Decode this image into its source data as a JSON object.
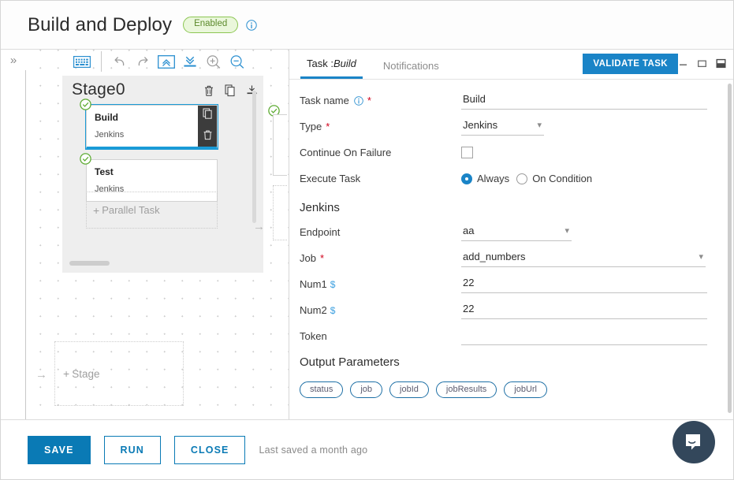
{
  "header": {
    "title": "Build and Deploy",
    "status_badge": "Enabled",
    "info_icon": "info-circle-icon",
    "badge_color": "#8cc653"
  },
  "canvas_toolbar": {
    "collapse_label": "»",
    "buttons": [
      {
        "name": "keyboard-icon",
        "glyph": "keyboard"
      },
      {
        "name": "undo-icon",
        "glyph": "undo"
      },
      {
        "name": "redo-icon",
        "glyph": "redo"
      },
      {
        "name": "collapse-all-icon",
        "glyph": "collapse-all"
      },
      {
        "name": "expand-all-icon",
        "glyph": "expand-all"
      },
      {
        "name": "zoom-in-icon",
        "glyph": "zoom-in"
      },
      {
        "name": "zoom-out-icon",
        "glyph": "zoom-out"
      }
    ]
  },
  "canvas": {
    "stage": {
      "title": "Stage0",
      "tools": [
        "delete-icon",
        "copy-icon",
        "collapse-icon"
      ],
      "tasks": [
        {
          "name": "Build",
          "type": "Jenkins",
          "selected": true
        },
        {
          "name": "Test",
          "type": "Jenkins",
          "selected": false
        }
      ],
      "parallel_task_label": "Parallel Task",
      "plus": "+"
    },
    "add_stage_label": "Stage",
    "add_stage_plus": "+"
  },
  "panel": {
    "tabs": [
      {
        "label_prefix": "Task :",
        "label_italic": "Build",
        "active": true,
        "name": "tab-task"
      },
      {
        "label_prefix": "Notifications",
        "label_italic": "",
        "active": false,
        "name": "tab-notifications"
      }
    ],
    "validate_button": "VALIDATE TASK",
    "window_controls": [
      "minimize-icon",
      "maximize-icon",
      "split-icon"
    ],
    "fields": {
      "task_name_label": "Task name",
      "task_name_value": "Build",
      "task_name_required": "*",
      "type_label": "Type",
      "type_required": "*",
      "type_value": "Jenkins",
      "type_options": [
        "Jenkins"
      ],
      "continue_on_failure_label": "Continue On Failure",
      "continue_on_failure_checked": false,
      "execute_task_label": "Execute Task",
      "execute_always_label": "Always",
      "execute_on_condition_label": "On Condition",
      "execute_selected": "Always"
    },
    "jenkins": {
      "section_title": "Jenkins",
      "endpoint_label": "Endpoint",
      "endpoint_value": "aa",
      "endpoint_options": [
        "aa"
      ],
      "job_label": "Job",
      "job_required": "*",
      "job_value": "add_numbers",
      "job_options": [
        "add_numbers"
      ],
      "num1_label": "Num1",
      "num1_value": "22",
      "num2_label": "Num2",
      "num2_value": "22",
      "token_label": "Token",
      "token_value": "",
      "dollar_marker": "$"
    },
    "output_parameters": {
      "title": "Output Parameters",
      "chips": [
        "status",
        "job",
        "jobId",
        "jobResults",
        "jobUrl"
      ]
    },
    "accent_color": "#1a84c7"
  },
  "footer": {
    "save_label": "SAVE",
    "run_label": "RUN",
    "close_label": "CLOSE",
    "last_saved": "Last saved a month ago"
  },
  "chat": {
    "name": "intercom-chat-icon"
  }
}
